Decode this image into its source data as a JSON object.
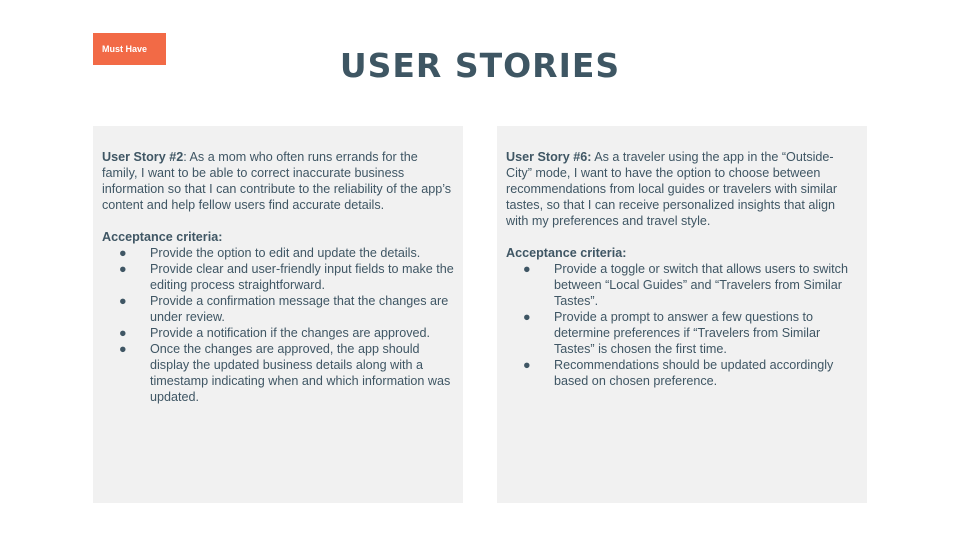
{
  "badge": "Must Have",
  "title": "USER STORIES",
  "left": {
    "story_label": "User Story #2",
    "story_text": ": As a mom who often runs errands for the family, I want to be able to correct inaccurate business information so that I can contribute to the reliability of the app’s content and help fellow users find accurate details.",
    "criteria_heading": "Acceptance criteria:",
    "criteria": [
      "Provide the option to edit and update the details.",
      "Provide clear and user-friendly input fields to make the editing process straightforward.",
      "Provide a confirmation message that the changes are under review.",
      "Provide a notification if the changes are approved.",
      "Once the changes are approved, the app should display the updated business details along with a timestamp indicating when and which information was updated."
    ]
  },
  "right": {
    "story_label": "User Story #6:",
    "story_text": " As a traveler using the app in the “Outside-City” mode, I want to have the option to choose between recommendations from local guides or travelers with similar tastes, so that I can receive personalized  insights that align with my preferences and travel style.",
    "criteria_heading": "Acceptance criteria:",
    "criteria": [
      "Provide a toggle or switch that allows users to switch between “Local Guides” and “Travelers from Similar Tastes”.",
      "Provide a prompt to answer a few questions to determine preferences if “Travelers from Similar Tastes” is chosen the first time.",
      "Recommendations should be updated accordingly based on chosen preference."
    ]
  },
  "bullet_glyph": "●"
}
